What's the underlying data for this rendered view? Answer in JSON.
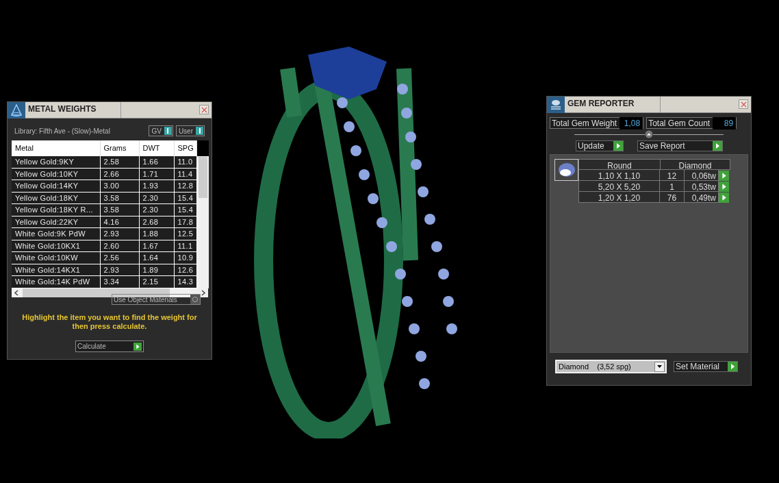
{
  "metal_weights": {
    "title": "METAL WEIGHTS",
    "library": "Library: Fifth Ave - (Slow)-Metal",
    "toggles": [
      {
        "label": "GV",
        "on": true
      },
      {
        "label": "User",
        "on": true
      }
    ],
    "table": {
      "columns": [
        "Metal",
        "Grams",
        "DWT",
        "SPG"
      ],
      "rows": [
        [
          "Yellow Gold:9KY",
          "2.58",
          "1.66",
          "11.0"
        ],
        [
          "Yellow Gold:10KY",
          "2.66",
          "1.71",
          "11.4"
        ],
        [
          "Yellow Gold:14KY",
          "3.00",
          "1.93",
          "12.8"
        ],
        [
          "Yellow Gold:18KY",
          "3.58",
          "2.30",
          "15.4"
        ],
        [
          "Yellow Gold:18KY R...",
          "3.58",
          "2.30",
          "15.4"
        ],
        [
          "Yellow Gold:22KY",
          "4.16",
          "2.68",
          "17.8"
        ],
        [
          "White Gold:9K PdW",
          "2.93",
          "1.88",
          "12.5"
        ],
        [
          "White Gold:10KX1",
          "2.60",
          "1.67",
          "11.1"
        ],
        [
          "White Gold:10KW",
          "2.56",
          "1.64",
          "10.9"
        ],
        [
          "White Gold:14KX1",
          "2.93",
          "1.89",
          "12.6"
        ],
        [
          "White Gold:14K PdW",
          "3.34",
          "2.15",
          "14.3"
        ]
      ]
    },
    "use_object_materials": {
      "label": "Use Object Materials",
      "checked": false
    },
    "hint": "Highlight the item you want to find the weight for then press calculate.",
    "calculate_button": "Calculate"
  },
  "gem_reporter": {
    "title": "GEM REPORTER",
    "stats": [
      {
        "label": "Total Gem Weight",
        "value": "1,08"
      },
      {
        "label": "Total Gem Count",
        "value": "89"
      }
    ],
    "buttons": [
      "Update",
      "Save Report"
    ],
    "gem_table": {
      "shape": "Round",
      "material": "Diamond",
      "rows": [
        {
          "size": "1,10 X 1,10",
          "count": "12",
          "weight": "0,06tw"
        },
        {
          "size": "5,20 X 5,20",
          "count": "1",
          "weight": "0,53tw"
        },
        {
          "size": "1,20 X 1,20",
          "count": "76",
          "weight": "0,49tw"
        }
      ]
    },
    "material_dropdown": "Diamond    (3,52 spg)",
    "set_material_button": "Set Material"
  }
}
